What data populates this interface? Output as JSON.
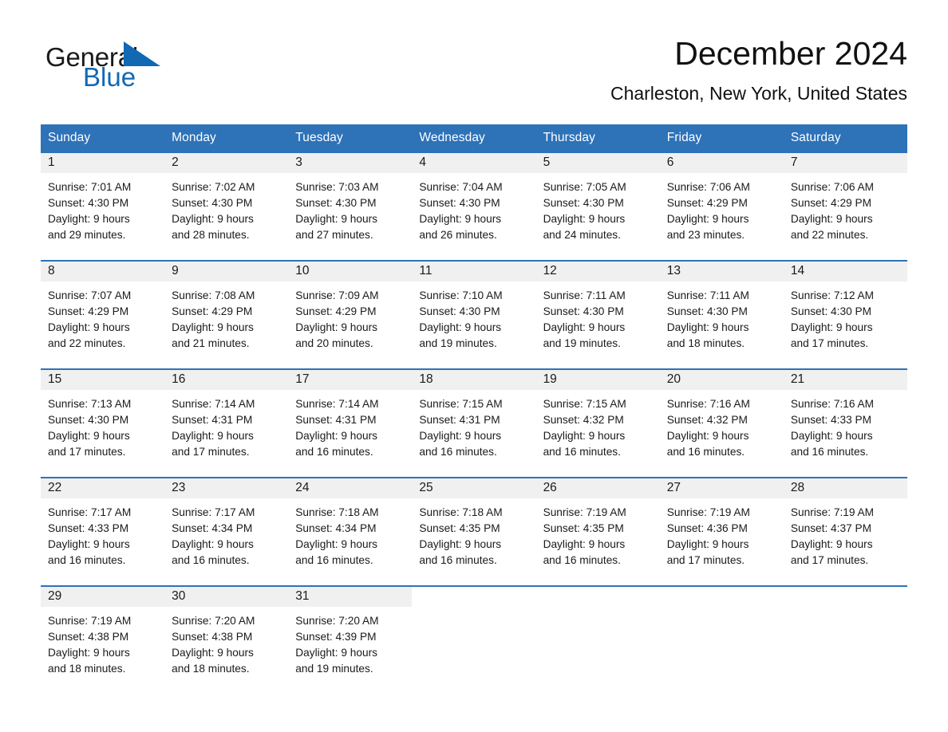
{
  "brand": {
    "name_part1": "General",
    "name_part2": "Blue",
    "triangle_icon": "triangle-icon",
    "accent_color": "#1168b3"
  },
  "header": {
    "month_title": "December 2024",
    "location": "Charleston, New York, United States"
  },
  "calendar": {
    "header_bg": "#2e72b8",
    "daynum_band_bg": "#f0f0f0",
    "weekdays": [
      "Sunday",
      "Monday",
      "Tuesday",
      "Wednesday",
      "Thursday",
      "Friday",
      "Saturday"
    ],
    "weeks": [
      [
        {
          "day": "1",
          "sunrise": "Sunrise: 7:01 AM",
          "sunset": "Sunset: 4:30 PM",
          "daylight_line1": "Daylight: 9 hours",
          "daylight_line2": "and 29 minutes."
        },
        {
          "day": "2",
          "sunrise": "Sunrise: 7:02 AM",
          "sunset": "Sunset: 4:30 PM",
          "daylight_line1": "Daylight: 9 hours",
          "daylight_line2": "and 28 minutes."
        },
        {
          "day": "3",
          "sunrise": "Sunrise: 7:03 AM",
          "sunset": "Sunset: 4:30 PM",
          "daylight_line1": "Daylight: 9 hours",
          "daylight_line2": "and 27 minutes."
        },
        {
          "day": "4",
          "sunrise": "Sunrise: 7:04 AM",
          "sunset": "Sunset: 4:30 PM",
          "daylight_line1": "Daylight: 9 hours",
          "daylight_line2": "and 26 minutes."
        },
        {
          "day": "5",
          "sunrise": "Sunrise: 7:05 AM",
          "sunset": "Sunset: 4:30 PM",
          "daylight_line1": "Daylight: 9 hours",
          "daylight_line2": "and 24 minutes."
        },
        {
          "day": "6",
          "sunrise": "Sunrise: 7:06 AM",
          "sunset": "Sunset: 4:29 PM",
          "daylight_line1": "Daylight: 9 hours",
          "daylight_line2": "and 23 minutes."
        },
        {
          "day": "7",
          "sunrise": "Sunrise: 7:06 AM",
          "sunset": "Sunset: 4:29 PM",
          "daylight_line1": "Daylight: 9 hours",
          "daylight_line2": "and 22 minutes."
        }
      ],
      [
        {
          "day": "8",
          "sunrise": "Sunrise: 7:07 AM",
          "sunset": "Sunset: 4:29 PM",
          "daylight_line1": "Daylight: 9 hours",
          "daylight_line2": "and 22 minutes."
        },
        {
          "day": "9",
          "sunrise": "Sunrise: 7:08 AM",
          "sunset": "Sunset: 4:29 PM",
          "daylight_line1": "Daylight: 9 hours",
          "daylight_line2": "and 21 minutes."
        },
        {
          "day": "10",
          "sunrise": "Sunrise: 7:09 AM",
          "sunset": "Sunset: 4:29 PM",
          "daylight_line1": "Daylight: 9 hours",
          "daylight_line2": "and 20 minutes."
        },
        {
          "day": "11",
          "sunrise": "Sunrise: 7:10 AM",
          "sunset": "Sunset: 4:30 PM",
          "daylight_line1": "Daylight: 9 hours",
          "daylight_line2": "and 19 minutes."
        },
        {
          "day": "12",
          "sunrise": "Sunrise: 7:11 AM",
          "sunset": "Sunset: 4:30 PM",
          "daylight_line1": "Daylight: 9 hours",
          "daylight_line2": "and 19 minutes."
        },
        {
          "day": "13",
          "sunrise": "Sunrise: 7:11 AM",
          "sunset": "Sunset: 4:30 PM",
          "daylight_line1": "Daylight: 9 hours",
          "daylight_line2": "and 18 minutes."
        },
        {
          "day": "14",
          "sunrise": "Sunrise: 7:12 AM",
          "sunset": "Sunset: 4:30 PM",
          "daylight_line1": "Daylight: 9 hours",
          "daylight_line2": "and 17 minutes."
        }
      ],
      [
        {
          "day": "15",
          "sunrise": "Sunrise: 7:13 AM",
          "sunset": "Sunset: 4:30 PM",
          "daylight_line1": "Daylight: 9 hours",
          "daylight_line2": "and 17 minutes."
        },
        {
          "day": "16",
          "sunrise": "Sunrise: 7:14 AM",
          "sunset": "Sunset: 4:31 PM",
          "daylight_line1": "Daylight: 9 hours",
          "daylight_line2": "and 17 minutes."
        },
        {
          "day": "17",
          "sunrise": "Sunrise: 7:14 AM",
          "sunset": "Sunset: 4:31 PM",
          "daylight_line1": "Daylight: 9 hours",
          "daylight_line2": "and 16 minutes."
        },
        {
          "day": "18",
          "sunrise": "Sunrise: 7:15 AM",
          "sunset": "Sunset: 4:31 PM",
          "daylight_line1": "Daylight: 9 hours",
          "daylight_line2": "and 16 minutes."
        },
        {
          "day": "19",
          "sunrise": "Sunrise: 7:15 AM",
          "sunset": "Sunset: 4:32 PM",
          "daylight_line1": "Daylight: 9 hours",
          "daylight_line2": "and 16 minutes."
        },
        {
          "day": "20",
          "sunrise": "Sunrise: 7:16 AM",
          "sunset": "Sunset: 4:32 PM",
          "daylight_line1": "Daylight: 9 hours",
          "daylight_line2": "and 16 minutes."
        },
        {
          "day": "21",
          "sunrise": "Sunrise: 7:16 AM",
          "sunset": "Sunset: 4:33 PM",
          "daylight_line1": "Daylight: 9 hours",
          "daylight_line2": "and 16 minutes."
        }
      ],
      [
        {
          "day": "22",
          "sunrise": "Sunrise: 7:17 AM",
          "sunset": "Sunset: 4:33 PM",
          "daylight_line1": "Daylight: 9 hours",
          "daylight_line2": "and 16 minutes."
        },
        {
          "day": "23",
          "sunrise": "Sunrise: 7:17 AM",
          "sunset": "Sunset: 4:34 PM",
          "daylight_line1": "Daylight: 9 hours",
          "daylight_line2": "and 16 minutes."
        },
        {
          "day": "24",
          "sunrise": "Sunrise: 7:18 AM",
          "sunset": "Sunset: 4:34 PM",
          "daylight_line1": "Daylight: 9 hours",
          "daylight_line2": "and 16 minutes."
        },
        {
          "day": "25",
          "sunrise": "Sunrise: 7:18 AM",
          "sunset": "Sunset: 4:35 PM",
          "daylight_line1": "Daylight: 9 hours",
          "daylight_line2": "and 16 minutes."
        },
        {
          "day": "26",
          "sunrise": "Sunrise: 7:19 AM",
          "sunset": "Sunset: 4:35 PM",
          "daylight_line1": "Daylight: 9 hours",
          "daylight_line2": "and 16 minutes."
        },
        {
          "day": "27",
          "sunrise": "Sunrise: 7:19 AM",
          "sunset": "Sunset: 4:36 PM",
          "daylight_line1": "Daylight: 9 hours",
          "daylight_line2": "and 17 minutes."
        },
        {
          "day": "28",
          "sunrise": "Sunrise: 7:19 AM",
          "sunset": "Sunset: 4:37 PM",
          "daylight_line1": "Daylight: 9 hours",
          "daylight_line2": "and 17 minutes."
        }
      ],
      [
        {
          "day": "29",
          "sunrise": "Sunrise: 7:19 AM",
          "sunset": "Sunset: 4:38 PM",
          "daylight_line1": "Daylight: 9 hours",
          "daylight_line2": "and 18 minutes."
        },
        {
          "day": "30",
          "sunrise": "Sunrise: 7:20 AM",
          "sunset": "Sunset: 4:38 PM",
          "daylight_line1": "Daylight: 9 hours",
          "daylight_line2": "and 18 minutes."
        },
        {
          "day": "31",
          "sunrise": "Sunrise: 7:20 AM",
          "sunset": "Sunset: 4:39 PM",
          "daylight_line1": "Daylight: 9 hours",
          "daylight_line2": "and 19 minutes."
        },
        {
          "day": "",
          "sunrise": "",
          "sunset": "",
          "daylight_line1": "",
          "daylight_line2": ""
        },
        {
          "day": "",
          "sunrise": "",
          "sunset": "",
          "daylight_line1": "",
          "daylight_line2": ""
        },
        {
          "day": "",
          "sunrise": "",
          "sunset": "",
          "daylight_line1": "",
          "daylight_line2": ""
        },
        {
          "day": "",
          "sunrise": "",
          "sunset": "",
          "daylight_line1": "",
          "daylight_line2": ""
        }
      ]
    ]
  }
}
